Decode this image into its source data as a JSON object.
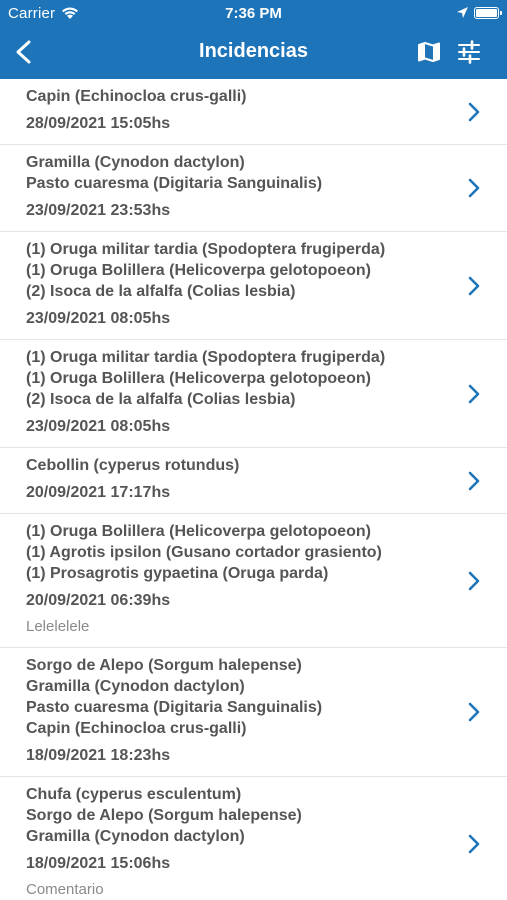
{
  "status_bar": {
    "carrier": "Carrier",
    "time": "7:36 PM"
  },
  "navbar": {
    "title": "Incidencias"
  },
  "icons": {
    "back": "chevron-left-icon",
    "map": "map-icon",
    "filter": "sliders-icon",
    "row": "chevron-right-icon"
  },
  "colors": {
    "header": "#1e74b8",
    "chevron": "#1e74b8",
    "text": "#555555",
    "comment": "#8a8a8a"
  },
  "incidents": [
    {
      "lines": [
        "Capin (Echinocloa crus-galli)"
      ],
      "date": "28/09/2021 15:05hs",
      "comment": ""
    },
    {
      "lines": [
        "Gramilla (Cynodon dactylon)",
        "Pasto cuaresma (Digitaria Sanguinalis)"
      ],
      "date": "23/09/2021 23:53hs",
      "comment": ""
    },
    {
      "lines": [
        "(1)  Oruga militar tardia (Spodoptera frugiperda)",
        "(1)  Oruga Bolillera (Helicoverpa gelotopoeon)",
        "(2)  Isoca de la alfalfa (Colias lesbia)"
      ],
      "date": "23/09/2021 08:05hs",
      "comment": ""
    },
    {
      "lines": [
        "(1)  Oruga militar tardia (Spodoptera frugiperda)",
        "(1)  Oruga Bolillera (Helicoverpa gelotopoeon)",
        "(2)  Isoca de la alfalfa (Colias lesbia)"
      ],
      "date": "23/09/2021 08:05hs",
      "comment": ""
    },
    {
      "lines": [
        "Cebollin (cyperus rotundus)"
      ],
      "date": "20/09/2021 17:17hs",
      "comment": ""
    },
    {
      "lines": [
        "(1)  Oruga Bolillera (Helicoverpa gelotopoeon)",
        "(1)  Agrotis ipsilon (Gusano cortador grasiento)",
        "(1)  Prosagrotis gypaetina (Oruga parda)"
      ],
      "date": "20/09/2021 06:39hs",
      "comment": "Lelelelele"
    },
    {
      "lines": [
        "Sorgo de Alepo (Sorgum halepense)",
        "Gramilla (Cynodon dactylon)",
        "Pasto cuaresma (Digitaria Sanguinalis)",
        "Capin (Echinocloa crus-galli)"
      ],
      "date": "18/09/2021 18:23hs",
      "comment": ""
    },
    {
      "lines": [
        "Chufa (cyperus esculentum)",
        "Sorgo de Alepo (Sorgum halepense)",
        "Gramilla (Cynodon dactylon)"
      ],
      "date": "18/09/2021 15:06hs",
      "comment": "Comentario"
    }
  ]
}
